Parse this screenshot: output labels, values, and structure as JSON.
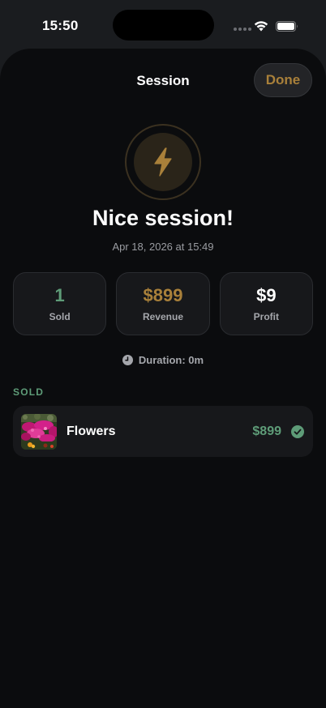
{
  "status_bar": {
    "time": "15:50",
    "icons": [
      "cellular-dots-icon",
      "wifi-icon",
      "battery-icon"
    ]
  },
  "header": {
    "title": "Session",
    "done_label": "Done"
  },
  "hero": {
    "icon": "lightning-bolt-icon",
    "headline": "Nice session!",
    "date": "Apr 18, 2026 at 15:49"
  },
  "stats": [
    {
      "value": "1",
      "label": "Sold",
      "color": "#5e9c78"
    },
    {
      "value": "$899",
      "label": "Revenue",
      "color": "#a9803a"
    },
    {
      "value": "$9",
      "label": "Profit",
      "color": "#ffffff"
    }
  ],
  "duration": {
    "icon": "clock-icon",
    "text": "Duration: 0m"
  },
  "sold_section": {
    "label": "SOLD",
    "items": [
      {
        "name": "Flowers",
        "price": "$899",
        "thumbnail": "flowers-photo",
        "status_icon": "checkmark-circle-icon"
      }
    ]
  },
  "colors": {
    "accent_gold": "#a9803a",
    "accent_green": "#5e9c78",
    "background": "#0b0c0e",
    "card": "#17181b"
  }
}
